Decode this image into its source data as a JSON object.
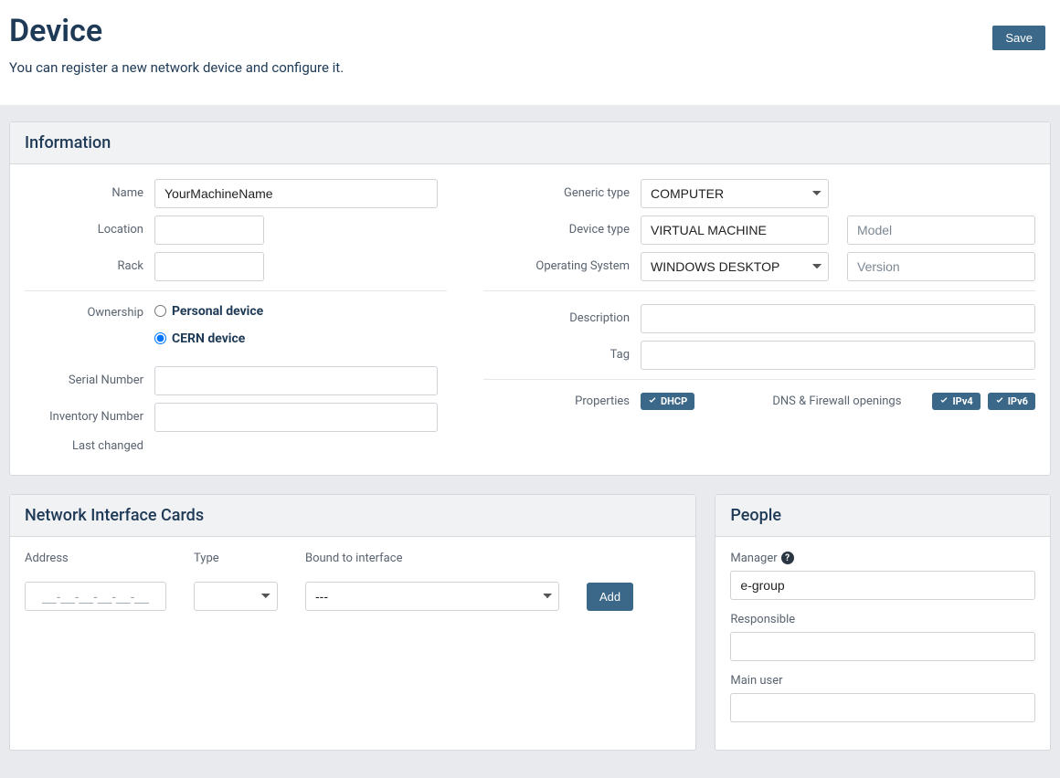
{
  "header": {
    "title": "Device",
    "subtitle": "You can register a new network device and configure it.",
    "save_label": "Save"
  },
  "panels": {
    "info_title": "Information",
    "nic_title": "Network Interface Cards",
    "people_title": "People"
  },
  "info": {
    "left": {
      "name_label": "Name",
      "name_value": "YourMachineName",
      "location_label": "Location",
      "location_value": "",
      "rack_label": "Rack",
      "rack_value": "",
      "ownership_label": "Ownership",
      "ownership_personal": "Personal device",
      "ownership_cern": "CERN device",
      "serial_label": "Serial Number",
      "serial_value": "",
      "inventory_label": "Inventory Number",
      "inventory_value": "",
      "last_changed_label": "Last changed"
    },
    "right": {
      "generic_type_label": "Generic type",
      "generic_type_value": "COMPUTER",
      "device_type_label": "Device type",
      "device_type_value": "VIRTUAL MACHINE",
      "model_placeholder": "Model",
      "os_label": "Operating System",
      "os_value": "WINDOWS DESKTOP",
      "version_placeholder": "Version",
      "description_label": "Description",
      "description_value": "",
      "tag_label": "Tag",
      "tag_value": "",
      "properties_label": "Properties",
      "dhcp_badge": "DHCP",
      "dns_label": "DNS & Firewall openings",
      "ipv4_badge": "IPv4",
      "ipv6_badge": "IPv6"
    }
  },
  "nic": {
    "address_label": "Address",
    "address_placeholder": "__-__-__-__-__-__",
    "type_label": "Type",
    "bound_label": "Bound to interface",
    "bound_value": "---",
    "add_label": "Add"
  },
  "people": {
    "manager_label": "Manager",
    "manager_value": "e-group",
    "responsible_label": "Responsible",
    "responsible_value": "",
    "main_user_label": "Main user",
    "main_user_value": ""
  }
}
